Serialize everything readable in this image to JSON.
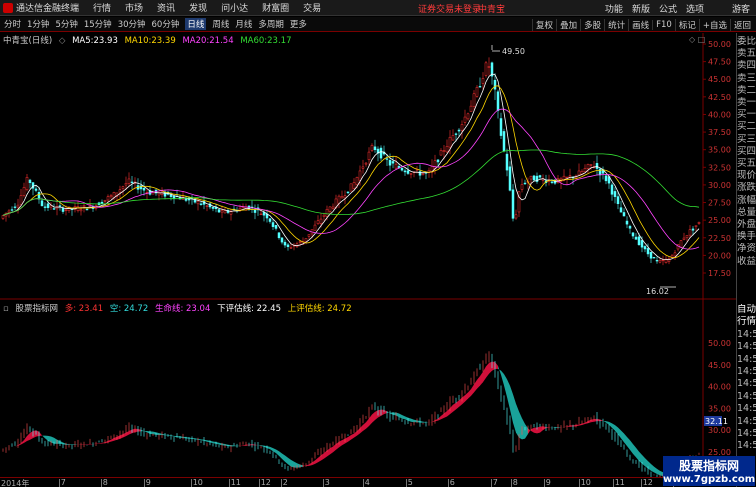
{
  "titlebar": {
    "app_title": "通达信金融终端",
    "menu": [
      "行情",
      "市场",
      "资讯",
      "发现",
      "问小达",
      "财富圈",
      "交易"
    ],
    "login_warning": "证券交易未登录",
    "stock_name": "中青宝",
    "right_menu": [
      "功能",
      "新版",
      "公式",
      "选项",
      "",
      "游客"
    ]
  },
  "toolbar": {
    "periods": [
      "分时",
      "1分钟",
      "5分钟",
      "15分钟",
      "30分钟",
      "60分钟",
      "日线",
      "周线",
      "月线",
      "多周期",
      "更多"
    ],
    "active_period": "日线",
    "tools": [
      "复权",
      "叠加",
      "多股",
      "统计",
      "画线",
      "F10",
      "标记",
      "+自选",
      "返回"
    ]
  },
  "main_panel": {
    "stock_label": "中青宝(日线)",
    "ma": [
      {
        "label": "MA5:",
        "value": "23.93",
        "color": "#ffffff"
      },
      {
        "label": "MA10:",
        "value": "23.39",
        "color": "#ffd700"
      },
      {
        "label": "MA20:",
        "value": "21.54",
        "color": "#ff44ff"
      },
      {
        "label": "MA60:",
        "value": "23.17",
        "color": "#33dd33"
      }
    ],
    "high_annotation": "49.50",
    "low_annotation": "16.02",
    "y_axis": [
      "50.00",
      "47.50",
      "45.00",
      "42.50",
      "40.00",
      "37.50",
      "35.00",
      "32.50",
      "30.00",
      "27.50",
      "25.00",
      "22.50",
      "20.00",
      "17.50"
    ]
  },
  "indicator_panel": {
    "name": "股票指标网",
    "items": [
      {
        "label": "多:",
        "value": "23.41",
        "color": "#ff3333"
      },
      {
        "label": "空:",
        "value": "24.72",
        "color": "#33dddd"
      },
      {
        "label": "生命线:",
        "value": "23.04",
        "color": "#ff44ff"
      },
      {
        "label": "下评估线:",
        "value": "22.45",
        "color": "#ffffff"
      },
      {
        "label": "上评估线:",
        "value": "24.72",
        "color": "#ffd700"
      }
    ],
    "y_axis": [
      "50.00",
      "45.00",
      "40.00",
      "35.00",
      "30.00",
      "25.00"
    ],
    "current_price": "32.11"
  },
  "side_panel": {
    "upper": [
      "委比",
      "卖五",
      "卖四",
      "卖三",
      "卖二",
      "卖一",
      "买一",
      "买二",
      "买三",
      "买四",
      "买五",
      "现价",
      "涨跌",
      "涨幅",
      "总量",
      "外盘",
      "换手",
      "净资",
      "收益"
    ],
    "lower": [
      "自动",
      "行情",
      "14:5",
      "14:5",
      "14:5",
      "14:5",
      "14:5",
      "14:5",
      "14:5",
      "14:5",
      "14:5",
      "14:5"
    ]
  },
  "bottom_axis": {
    "year": "2014年",
    "ticks": [
      "7",
      "8",
      "9",
      "10",
      "11",
      "12",
      "2",
      "3",
      "4",
      "5",
      "6",
      "7",
      "8",
      "9",
      "10",
      "11",
      "12",
      "2"
    ]
  },
  "watermark": {
    "title": "股票指标网",
    "url": "www.7gpzb.com"
  }
}
